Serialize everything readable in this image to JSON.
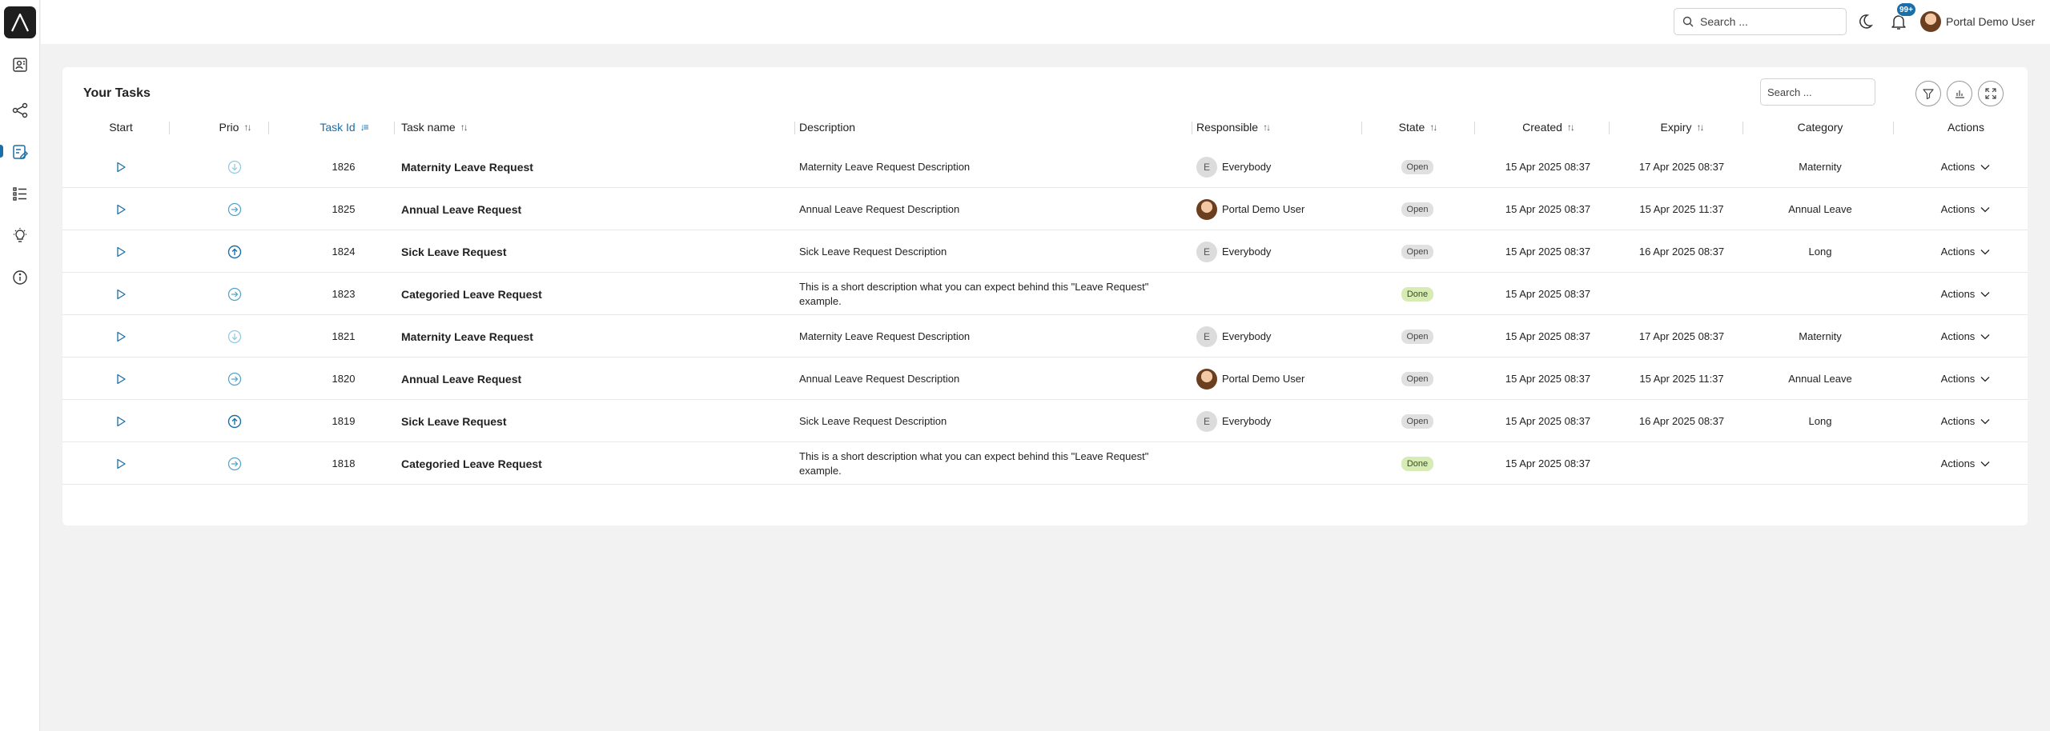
{
  "header": {
    "search_placeholder": "Search ...",
    "notification_count": "99+",
    "user_name": "Portal Demo User"
  },
  "sidebar": {
    "items": [
      {
        "icon": "logo-icon"
      },
      {
        "icon": "dashboard-icon"
      },
      {
        "icon": "process-icon"
      },
      {
        "icon": "tasks-icon",
        "active": true
      },
      {
        "icon": "list-icon"
      },
      {
        "icon": "lightbulb-icon"
      },
      {
        "icon": "info-icon"
      }
    ]
  },
  "card": {
    "title": "Your Tasks",
    "search_placeholder": "Search ..."
  },
  "table": {
    "columns": {
      "start": "Start",
      "prio": "Prio",
      "task_id": "Task Id",
      "task_name": "Task name",
      "description": "Description",
      "responsible": "Responsible",
      "state": "State",
      "created": "Created",
      "expiry": "Expiry",
      "category": "Category",
      "actions": "Actions"
    },
    "rows": [
      {
        "prio": "low",
        "id": "1826",
        "name": "Maternity Leave Request",
        "desc1": "Maternity Leave Request Description",
        "desc2": "",
        "resp_type": "letter",
        "resp_initial": "E",
        "responsible": "Everybody",
        "state": "Open",
        "created": "15 Apr 2025 08:37",
        "expiry": "17 Apr 2025 08:37",
        "category": "Maternity",
        "actions": "Actions"
      },
      {
        "prio": "normal",
        "id": "1825",
        "name": "Annual Leave Request",
        "desc1": "Annual Leave Request Description",
        "desc2": "",
        "resp_type": "avatar",
        "resp_initial": "",
        "responsible": "Portal Demo User",
        "state": "Open",
        "created": "15 Apr 2025 08:37",
        "expiry": "15 Apr 2025 11:37",
        "category": "Annual Leave",
        "actions": "Actions"
      },
      {
        "prio": "high",
        "id": "1824",
        "name": "Sick Leave Request",
        "desc1": "Sick Leave Request Description",
        "desc2": "",
        "resp_type": "letter",
        "resp_initial": "E",
        "responsible": "Everybody",
        "state": "Open",
        "created": "15 Apr 2025 08:37",
        "expiry": "16 Apr 2025 08:37",
        "category": "Long",
        "actions": "Actions"
      },
      {
        "prio": "normal",
        "id": "1823",
        "name": "Categoried Leave Request",
        "desc1": "This is a short description what you can expect behind this \"Leave Request\"",
        "desc2": "example.",
        "resp_type": "none",
        "resp_initial": "",
        "responsible": "",
        "state": "Done",
        "created": "15 Apr 2025 08:37",
        "expiry": "",
        "category": "",
        "actions": "Actions"
      },
      {
        "prio": "low",
        "id": "1821",
        "name": "Maternity Leave Request",
        "desc1": "Maternity Leave Request Description",
        "desc2": "",
        "resp_type": "letter",
        "resp_initial": "E",
        "responsible": "Everybody",
        "state": "Open",
        "created": "15 Apr 2025 08:37",
        "expiry": "17 Apr 2025 08:37",
        "category": "Maternity",
        "actions": "Actions"
      },
      {
        "prio": "normal",
        "id": "1820",
        "name": "Annual Leave Request",
        "desc1": "Annual Leave Request Description",
        "desc2": "",
        "resp_type": "avatar",
        "resp_initial": "",
        "responsible": "Portal Demo User",
        "state": "Open",
        "created": "15 Apr 2025 08:37",
        "expiry": "15 Apr 2025 11:37",
        "category": "Annual Leave",
        "actions": "Actions"
      },
      {
        "prio": "high",
        "id": "1819",
        "name": "Sick Leave Request",
        "desc1": "Sick Leave Request Description",
        "desc2": "",
        "resp_type": "letter",
        "resp_initial": "E",
        "responsible": "Everybody",
        "state": "Open",
        "created": "15 Apr 2025 08:37",
        "expiry": "16 Apr 2025 08:37",
        "category": "Long",
        "actions": "Actions"
      },
      {
        "prio": "normal",
        "id": "1818",
        "name": "Categoried Leave Request",
        "desc1": "This is a short description what you can expect behind this \"Leave Request\"",
        "desc2": "example.",
        "resp_type": "none",
        "resp_initial": "",
        "responsible": "",
        "state": "Done",
        "created": "15 Apr 2025 08:37",
        "expiry": "",
        "category": "",
        "actions": "Actions"
      }
    ]
  },
  "colors": {
    "accent": "#1a6fa8",
    "done_pill": "#d6ecb4",
    "open_pill": "#e0e0e0",
    "page_bg": "#f2f2f2"
  }
}
